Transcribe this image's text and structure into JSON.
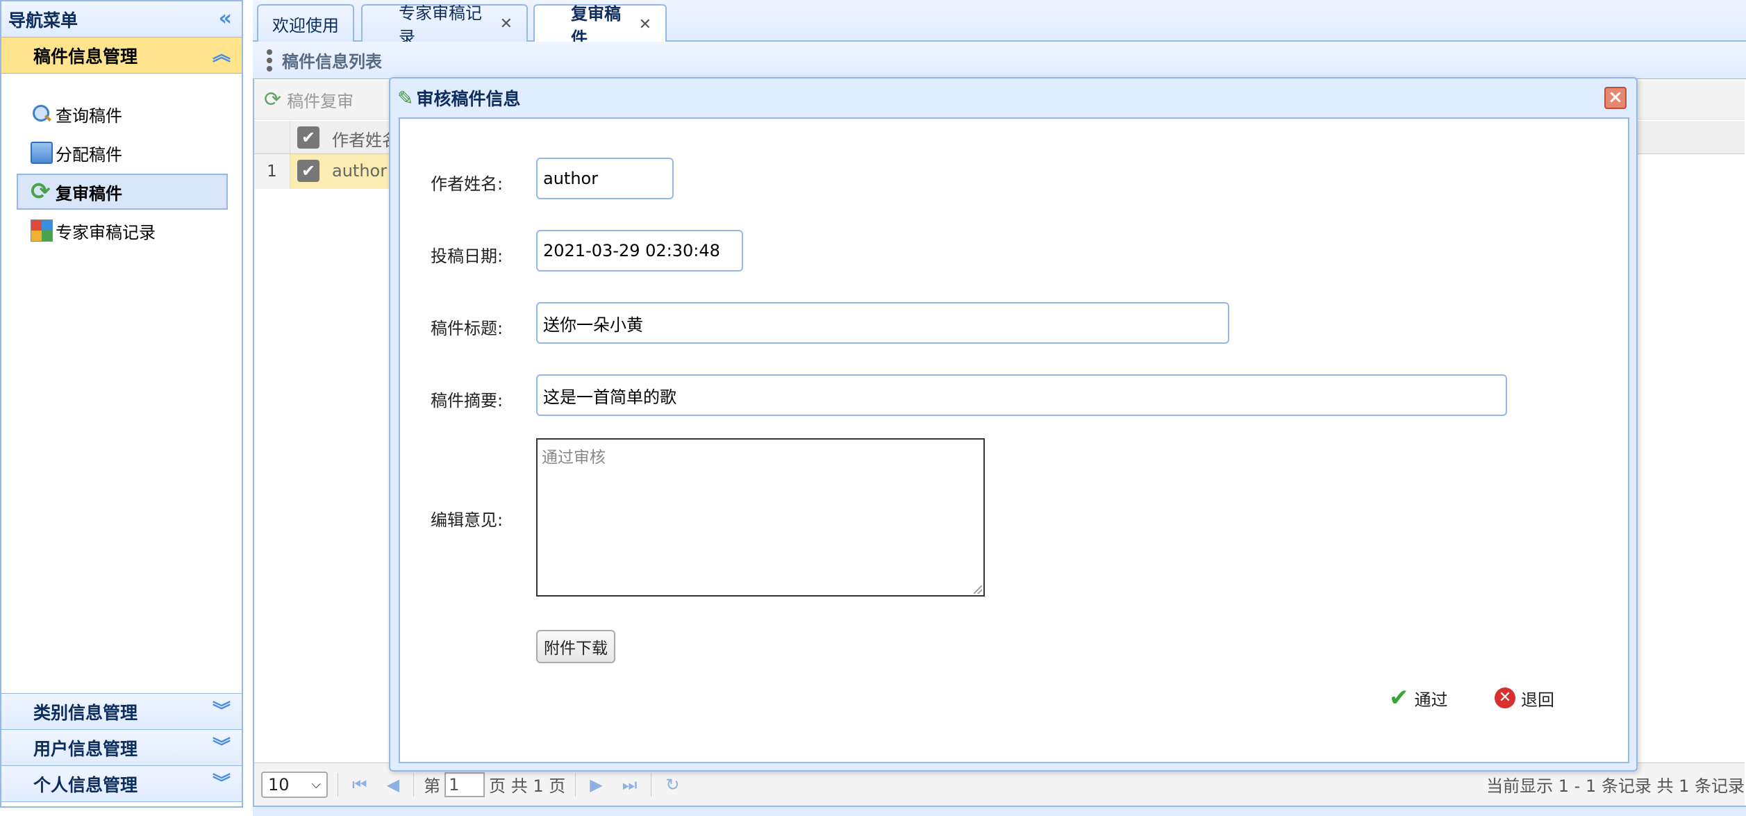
{
  "nav": {
    "title": "导航菜单",
    "active_section": "稿件信息管理",
    "items": [
      {
        "label": "查询稿件",
        "icon": "search-icon"
      },
      {
        "label": "分配稿件",
        "icon": "document-icon"
      },
      {
        "label": "复审稿件",
        "icon": "refresh-icon"
      },
      {
        "label": "专家审稿记录",
        "icon": "grid-icon"
      }
    ],
    "sections": [
      "类别信息管理",
      "用户信息管理",
      "个人信息管理"
    ]
  },
  "tabs": [
    {
      "label": "欢迎使用"
    },
    {
      "label": "专家审稿记录"
    },
    {
      "label": "复审稿件"
    }
  ],
  "panel": {
    "title": "稿件信息列表",
    "toolbar_button": "稿件复审",
    "column_header": "作者姓名",
    "row": {
      "index": "1",
      "author": "author"
    }
  },
  "pager": {
    "page_size": "10",
    "page_prefix": "第",
    "page_value": "1",
    "page_suffix": "页 共 1 页",
    "info": "当前显示 1 - 1 条记录 共 1 条记录"
  },
  "dialog": {
    "title": "审核稿件信息",
    "fields": {
      "author_label": "作者姓名:",
      "author_value": "author",
      "date_label": "投稿日期:",
      "date_value": "2021-03-29 02:30:48",
      "title_label": "稿件标题:",
      "title_value": "送你一朵小黄",
      "abstract_label": "稿件摘要:",
      "abstract_value": "这是一首简单的歌",
      "opinion_label": "编辑意见:",
      "opinion_placeholder": "通过审核"
    },
    "attach_button": "附件下载",
    "approve_button": "通过",
    "reject_button": "退回"
  }
}
